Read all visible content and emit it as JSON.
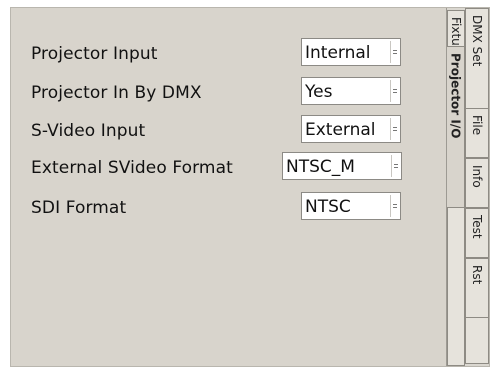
{
  "settings": [
    {
      "label": "Projector Input",
      "value": "Internal"
    },
    {
      "label": "Projector In By DMX",
      "value": "Yes"
    },
    {
      "label": "S-Video Input",
      "value": "External"
    },
    {
      "label": "External SVideo Format",
      "value": "NTSC_M"
    },
    {
      "label": "SDI Format",
      "value": "NTSC"
    }
  ],
  "tabs": {
    "inner": [
      "Fixture",
      "Projector I/O"
    ],
    "outer": [
      "DMX Set",
      "File",
      "Info",
      "Test",
      "Rst"
    ]
  },
  "colors": {
    "panel": "#d8d4cc",
    "field": "#ffffff"
  }
}
